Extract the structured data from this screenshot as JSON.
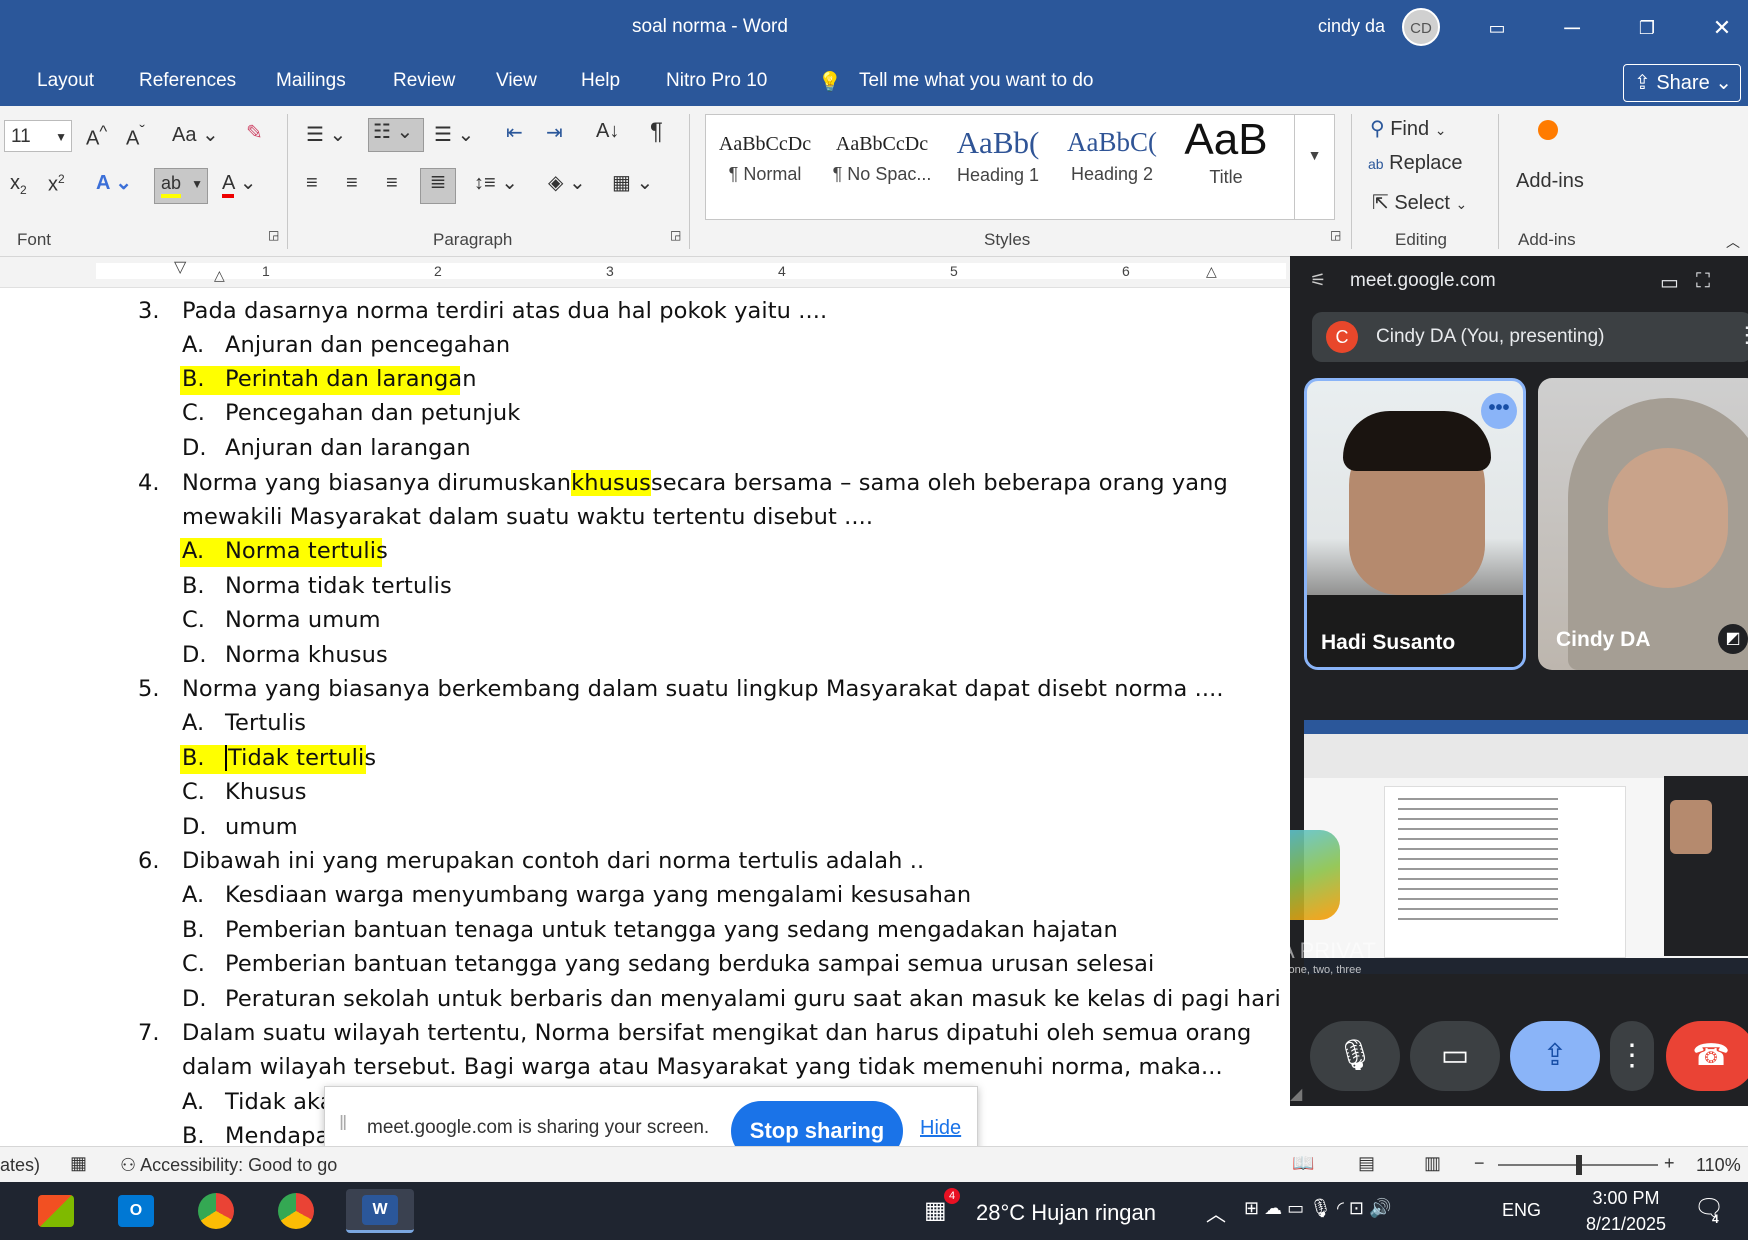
{
  "window": {
    "title": "soal norma  -  Word",
    "user": "cindy da",
    "avatar_initials": "CD"
  },
  "menu": {
    "tabs": [
      "Layout",
      "References",
      "Mailings",
      "Review",
      "View",
      "Help",
      "Nitro Pro 10"
    ],
    "tell_me": "Tell me what you want to do",
    "share": "Share"
  },
  "ribbon": {
    "font_size": "11",
    "font_label": "Font",
    "paragraph_label": "Paragraph",
    "styles_label": "Styles",
    "editing_label": "Editing",
    "addins_label": "Add-ins",
    "styles": [
      {
        "sample": "AaBbCcDc",
        "name": "¶ Normal"
      },
      {
        "sample": "AaBbCcDc",
        "name": "¶ No Spac..."
      },
      {
        "sample": "AaBb(",
        "name": "Heading 1"
      },
      {
        "sample": "AaBbC(",
        "name": "Heading 2"
      },
      {
        "sample": "AaB",
        "name": "Title"
      }
    ],
    "find": "Find",
    "replace": "Replace",
    "select": "Select",
    "addins": "Add-ins"
  },
  "ruler": {
    "numbers": [
      "1",
      "2",
      "3",
      "4",
      "5",
      "6"
    ]
  },
  "document": {
    "q3": {
      "num": "3.",
      "text": "Pada dasarnya norma terdiri atas dua hal pokok yaitu ....",
      "a": [
        "A.",
        "Anjuran dan pencegahan"
      ],
      "b": [
        "B.",
        "Perintah dan larangan"
      ],
      "c": [
        "C.",
        "Pencegahan dan petunjuk"
      ],
      "d": [
        "D.",
        "Anjuran dan larangan"
      ]
    },
    "q4": {
      "num": "4.",
      "t1": "Norma yang biasanya dirumuskan",
      "t_hl": "khusus",
      "t2": "secara bersama – sama oleh beberapa orang yang",
      "line2": "mewakili Masyarakat dalam suatu waktu tertentu disebut ....",
      "a": [
        "A.",
        "Norma tertulis"
      ],
      "b": [
        "B.",
        "Norma tidak tertulis"
      ],
      "c": [
        "C.",
        "Norma umum"
      ],
      "d": [
        "D.",
        "Norma khusus"
      ]
    },
    "q5": {
      "num": "5.",
      "text": "Norma yang biasanya berkembang dalam suatu lingkup Masyarakat dapat disebt norma ....",
      "a": [
        "A.",
        "Tertulis"
      ],
      "b": [
        "B.",
        "Tidak tertulis"
      ],
      "c": [
        "C.",
        "Khusus"
      ],
      "d": [
        "D.",
        "umum"
      ]
    },
    "q6": {
      "num": "6.",
      "text": "Dibawah ini yang merupakan contoh dari norma tertulis adalah ..",
      "a": [
        "A.",
        "Kesdiaan warga menyumbang warga yang mengalami kesusahan"
      ],
      "b": [
        "B.",
        "Pemberian bantuan tenaga untuk tetangga yang sedang mengadakan hajatan"
      ],
      "c": [
        "C.",
        "Pemberian bantuan tetangga yang sedang berduka sampai semua urusan selesai"
      ],
      "d": [
        "D.",
        "Peraturan sekolah untuk berbaris dan menyalami guru saat akan masuk ke kelas di pagi hari"
      ]
    },
    "q7": {
      "num": "7.",
      "text": "Dalam suatu wilayah tertentu, Norma bersifat mengikat dan harus dipatuhi oleh semua orang",
      "line2": "dalam wilayah tersebut. Bagi warga atau Masyarakat yang tidak memenuhi norma, maka...",
      "a": [
        "A.",
        "Tidak aka"
      ],
      "b": [
        "B.",
        "Mendapa"
      ]
    }
  },
  "statusbar": {
    "left": "ates)",
    "accessibility": "Accessibility: Good to go",
    "zoom": "110%"
  },
  "meet": {
    "url": "meet.google.com",
    "presenting": "Cindy DA (You, presenting)",
    "presenter_initial": "C",
    "tile1_name": "Hadi Susanto",
    "tile2_name": "Cindy DA",
    "watermark": "A PRIVAT",
    "watermark_sub": "s one, two, three"
  },
  "sharebar": {
    "message": "meet.google.com is sharing your screen.",
    "stop": "Stop sharing",
    "hide": "Hide"
  },
  "taskbar": {
    "weather": "28°C  Hujan ringan",
    "lang": "ENG",
    "time": "3:00 PM",
    "date": "8/21/2025",
    "weather_badge": "4",
    "notif": "4"
  }
}
